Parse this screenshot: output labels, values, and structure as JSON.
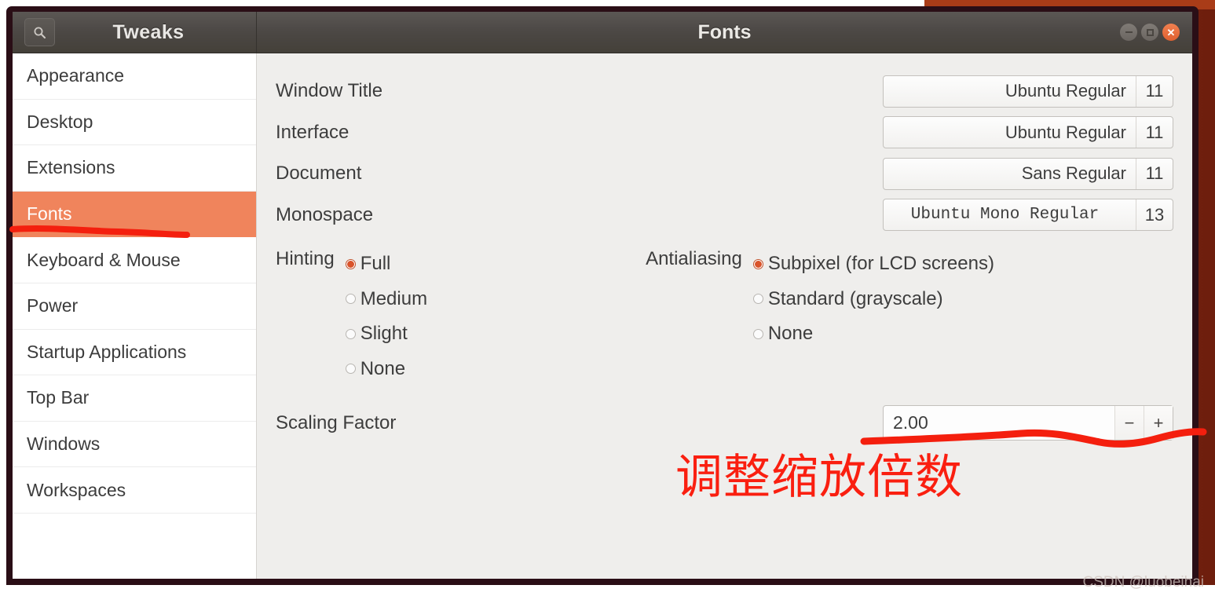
{
  "window": {
    "app_title": "Tweaks",
    "page_title": "Fonts",
    "search_icon": "search-icon",
    "controls": {
      "minimize": "minimize-icon",
      "maximize": "maximize-icon",
      "close": "close-icon"
    }
  },
  "sidebar": {
    "items": [
      {
        "label": "Appearance",
        "selected": false
      },
      {
        "label": "Desktop",
        "selected": false
      },
      {
        "label": "Extensions",
        "selected": false
      },
      {
        "label": "Fonts",
        "selected": true
      },
      {
        "label": "Keyboard & Mouse",
        "selected": false
      },
      {
        "label": "Power",
        "selected": false
      },
      {
        "label": "Startup Applications",
        "selected": false
      },
      {
        "label": "Top Bar",
        "selected": false
      },
      {
        "label": "Windows",
        "selected": false
      },
      {
        "label": "Workspaces",
        "selected": false
      }
    ]
  },
  "fonts": {
    "rows": [
      {
        "label": "Window Title",
        "font": "Ubuntu Regular",
        "size": "11",
        "mono": false
      },
      {
        "label": "Interface",
        "font": "Ubuntu Regular",
        "size": "11",
        "mono": false
      },
      {
        "label": "Document",
        "font": "Sans Regular",
        "size": "11",
        "mono": false
      },
      {
        "label": "Monospace",
        "font": "Ubuntu Mono Regular",
        "size": "13",
        "mono": true
      }
    ]
  },
  "hinting": {
    "label": "Hinting",
    "options": [
      {
        "label": "Full",
        "selected": true
      },
      {
        "label": "Medium",
        "selected": false
      },
      {
        "label": "Slight",
        "selected": false
      },
      {
        "label": "None",
        "selected": false
      }
    ]
  },
  "antialiasing": {
    "label": "Antialiasing",
    "options": [
      {
        "label": "Subpixel (for LCD screens)",
        "selected": true
      },
      {
        "label": "Standard (grayscale)",
        "selected": false
      },
      {
        "label": "None",
        "selected": false
      }
    ]
  },
  "scaling": {
    "label": "Scaling Factor",
    "value": "2.00",
    "decrement": "−",
    "increment": "+"
  },
  "annotations": {
    "note_text": "调整缩放倍数",
    "watermark": "CSDN @luobeihai",
    "highlight_color": "#fa1f10",
    "accent_color": "#f0845c"
  }
}
